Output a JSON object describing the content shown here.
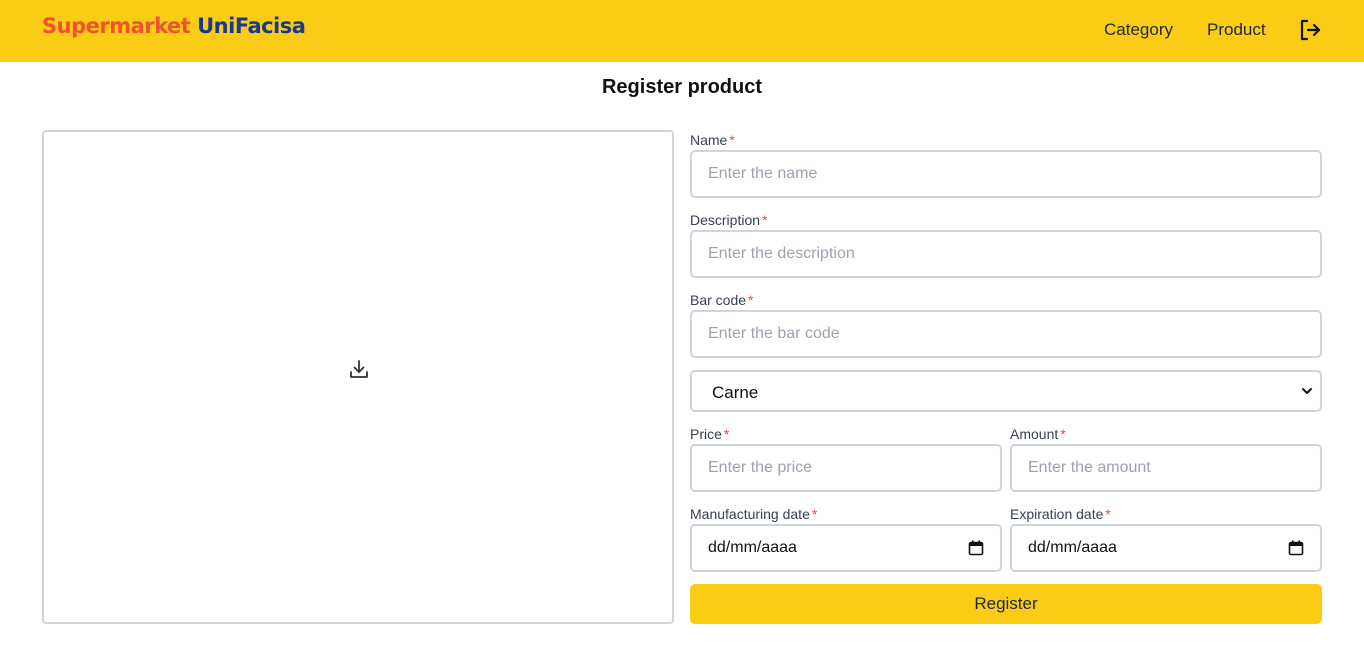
{
  "header": {
    "brand_part1": "Supermarket",
    "brand_part2": "UniFacisa",
    "nav": {
      "category": "Category",
      "product": "Product"
    },
    "logout_icon": "logout-icon"
  },
  "page": {
    "title": "Register product"
  },
  "upload": {
    "icon": "download-icon"
  },
  "form": {
    "required_mark": "*",
    "name": {
      "label": "Name",
      "placeholder": "Enter the name"
    },
    "description": {
      "label": "Description",
      "placeholder": "Enter the description"
    },
    "barcode": {
      "label": "Bar code",
      "placeholder": "Enter the bar code"
    },
    "category_select": {
      "selected": "Carne"
    },
    "price": {
      "label": "Price",
      "placeholder": "Enter the price"
    },
    "amount": {
      "label": "Amount",
      "placeholder": "Enter the amount"
    },
    "manufacturing_date": {
      "label": "Manufacturing date",
      "value": "dd/mm/aaaa"
    },
    "expiration_date": {
      "label": "Expiration date",
      "value": "dd/mm/aaaa"
    },
    "submit_label": "Register"
  },
  "colors": {
    "accent": "#facc15",
    "brand_red": "#f0522e",
    "brand_blue": "#163b8c",
    "required": "#ef4444"
  }
}
